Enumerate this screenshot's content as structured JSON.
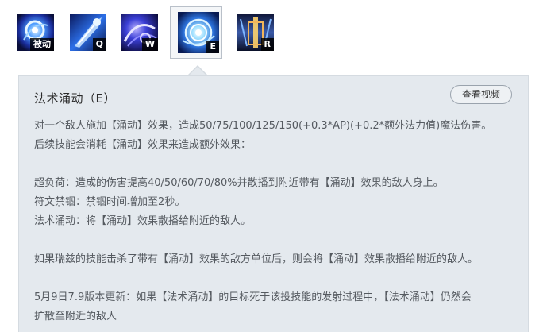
{
  "skills": [
    {
      "id": "passive",
      "key": "被动",
      "icon": "passive-rune-icon"
    },
    {
      "id": "q",
      "key": "Q",
      "icon": "overload-bolt-icon"
    },
    {
      "id": "w",
      "key": "W",
      "icon": "rune-prison-icon"
    },
    {
      "id": "e",
      "key": "E",
      "icon": "spell-flux-icon",
      "selected": true
    },
    {
      "id": "r",
      "key": "R",
      "icon": "realm-warp-icon"
    }
  ],
  "panel": {
    "title": "法术涌动（E）",
    "video_button": "查看视频",
    "lines": [
      "对一个敌人施加【涌动】效果，造成50/75/100/125/150(+0.3*AP)(+0.2*额外法力值)魔法伤害。",
      "后续技能会消耗【涌动】效果来造成额外效果：",
      "",
      "超负荷：造成的伤害提高40/50/60/70/80%并散播到附近带有【涌动】效果的敌人身上。",
      "符文禁锢：禁锢时间增加至2秒。",
      "法术涌动：将【涌动】效果散播给附近的敌人。",
      "",
      "如果瑞兹的技能击杀了带有【涌动】效果的敌方单位后，则会将【涌动】效果散播给附近的敌人。",
      "",
      "5月9日7.9版本更新：如果【法术涌动】的目标死于该投技能的发射过程中，【法术涌动】仍然会",
      "扩散至附近的敌人"
    ]
  },
  "colors": {
    "panel_bg": "#e4e9ee",
    "text": "#555a60",
    "title": "#2b2b2b",
    "rune_blue": "#2f7bff"
  }
}
